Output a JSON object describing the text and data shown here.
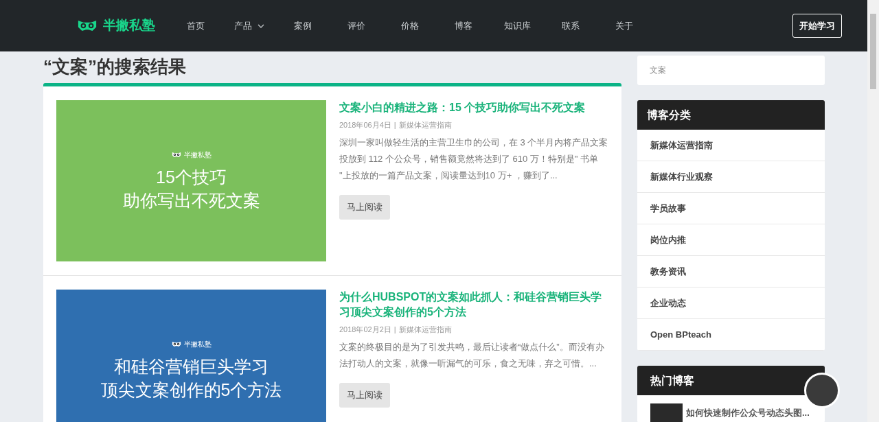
{
  "header": {
    "logo": "半撇私塾",
    "nav": [
      {
        "label": "首页",
        "dropdown": false
      },
      {
        "label": "产品",
        "dropdown": true
      },
      {
        "label": "案例",
        "dropdown": false
      },
      {
        "label": "评价",
        "dropdown": false
      },
      {
        "label": "价格",
        "dropdown": false
      },
      {
        "label": "博客",
        "dropdown": false
      },
      {
        "label": "知识库",
        "dropdown": false
      },
      {
        "label": "联系",
        "dropdown": false
      },
      {
        "label": "关于",
        "dropdown": false
      }
    ],
    "cta": "开始学习"
  },
  "page_title": "“文案”的搜索结果",
  "articles": [
    {
      "cover": {
        "color": "#7cc05c",
        "brand": "半撇私塾",
        "lines": [
          "15个技巧",
          "助你写出不死文案"
        ]
      },
      "title": "文案小白的精进之路：15 个技巧助你写出不死文案",
      "date": "2018年06月4日",
      "separator": "|",
      "category": "新媒体运营指南",
      "excerpt": "深圳一家叫做轻生活的主营卫生巾的公司，在 3 个半月内将产品文案投放到 112 个公众号，销售额竟然将达到了 610 万！特别是\" 书单 \"上投放的一篇产品文案，阅读量达到10 万+ ，赚到了...",
      "button": "马上阅读"
    },
    {
      "cover": {
        "color": "#2f6fb0",
        "brand": "半撇私塾",
        "lines": [
          "和硅谷营销巨头学习",
          "顶尖文案创作的5个方法"
        ]
      },
      "title": "为什么HUBSPOT的文案如此抓人：和硅谷营销巨头学习顶尖文案创作的5个方法",
      "date": "2018年02月2日",
      "separator": "|",
      "category": "新媒体运营指南",
      "excerpt": "文案的终极目的是为了引发共鸣，最后让读者“做点什么”。而没有办法打动人的文案，就像一听漏气的可乐，食之无味，弃之可惜。...",
      "button": "马上阅读"
    }
  ],
  "sidebar": {
    "search": {
      "value": "文案"
    },
    "categories": {
      "title": "博客分类",
      "items": [
        "新媒体运营指南",
        "新媒体行业观察",
        "学员故事",
        "岗位内推",
        "教务资讯",
        "企业动态",
        "Open BPteach"
      ]
    },
    "hot": {
      "title": "热门博客",
      "items": [
        "如何快速制作公众号动态头图..."
      ]
    }
  }
}
